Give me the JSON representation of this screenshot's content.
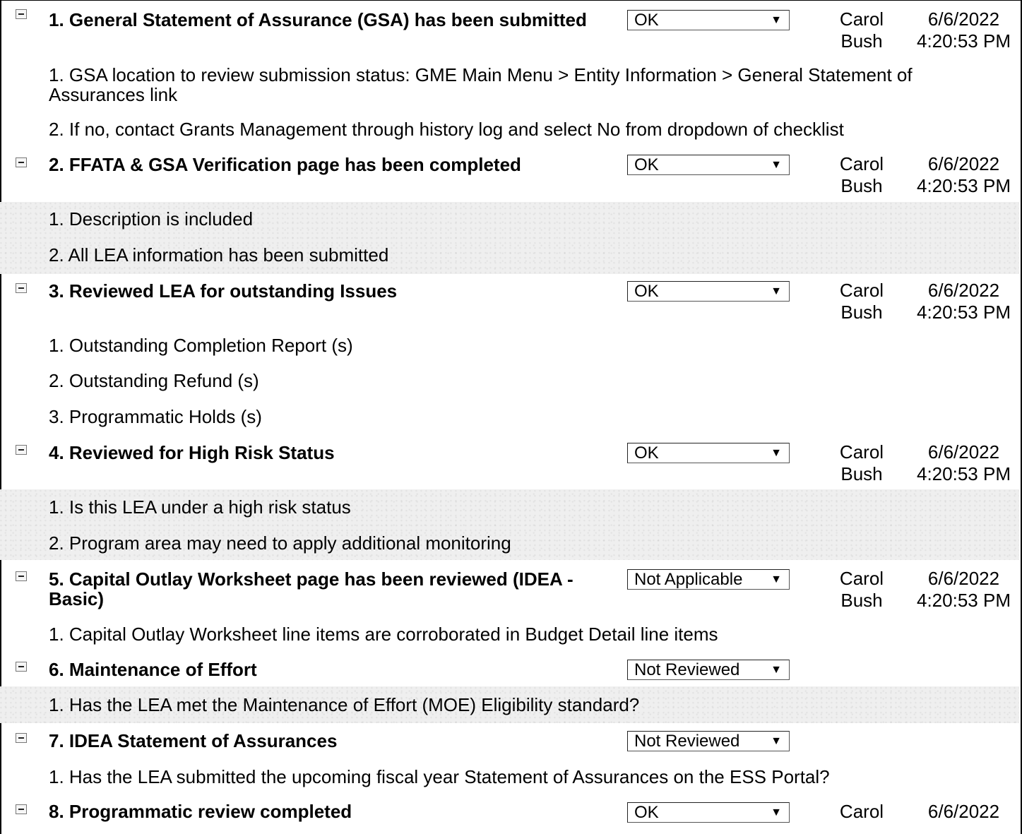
{
  "items": [
    {
      "title": "1. General Statement of Assurance (GSA) has been submitted",
      "status": "OK",
      "reviewer": "Carol Bush",
      "date": "6/6/2022",
      "time": "4:20:53 PM",
      "subitems": [
        "1. GSA location to review submission status: GME Main Menu > Entity Information > General Statement of Assurances link",
        "2. If no, contact Grants Management through history log and select No from dropdown of checklist"
      ]
    },
    {
      "title": "2. FFATA & GSA Verification page has been completed",
      "status": "OK",
      "reviewer": "Carol Bush",
      "date": "6/6/2022",
      "time": "4:20:53 PM",
      "subitems": [
        "1. Description is included",
        "2. All LEA information has been submitted"
      ]
    },
    {
      "title": "3. Reviewed LEA for outstanding Issues",
      "status": "OK",
      "reviewer": "Carol Bush",
      "date": "6/6/2022",
      "time": "4:20:53 PM",
      "subitems": [
        "1. Outstanding Completion Report (s)",
        "2. Outstanding Refund (s)",
        "3. Programmatic Holds (s)"
      ]
    },
    {
      "title": "4. Reviewed for High Risk Status",
      "status": "OK",
      "reviewer": "Carol Bush",
      "date": "6/6/2022",
      "time": "4:20:53 PM",
      "subitems": [
        "1. Is this LEA under a high risk status",
        "2. Program area may need to apply additional monitoring"
      ]
    },
    {
      "title": "5. Capital Outlay Worksheet page has been reviewed (IDEA - Basic)",
      "status": "Not Applicable",
      "reviewer": "Carol Bush",
      "date": "6/6/2022",
      "time": "4:20:53 PM",
      "subitems": [
        "1. Capital Outlay Worksheet line items are corroborated in Budget Detail line items"
      ]
    },
    {
      "title": "6. Maintenance of Effort",
      "status": "Not Reviewed",
      "reviewer": "",
      "date": "",
      "time": "",
      "subitems": [
        "1. Has the LEA met the Maintenance of Effort (MOE) Eligibility standard?"
      ]
    },
    {
      "title": "7. IDEA Statement of Assurances",
      "status": "Not Reviewed",
      "reviewer": "",
      "date": "",
      "time": "",
      "subitems": [
        "1. Has the LEA submitted the upcoming fiscal year Statement of Assurances on the ESS Portal?"
      ]
    },
    {
      "title": "8. Programmatic review completed",
      "status": "OK",
      "reviewer": "Carol",
      "date": "6/6/2022",
      "time": "",
      "subitems": []
    }
  ],
  "icons": {
    "collapse": "collapse-minus-icon",
    "dropdown": "dropdown-arrow-icon"
  }
}
